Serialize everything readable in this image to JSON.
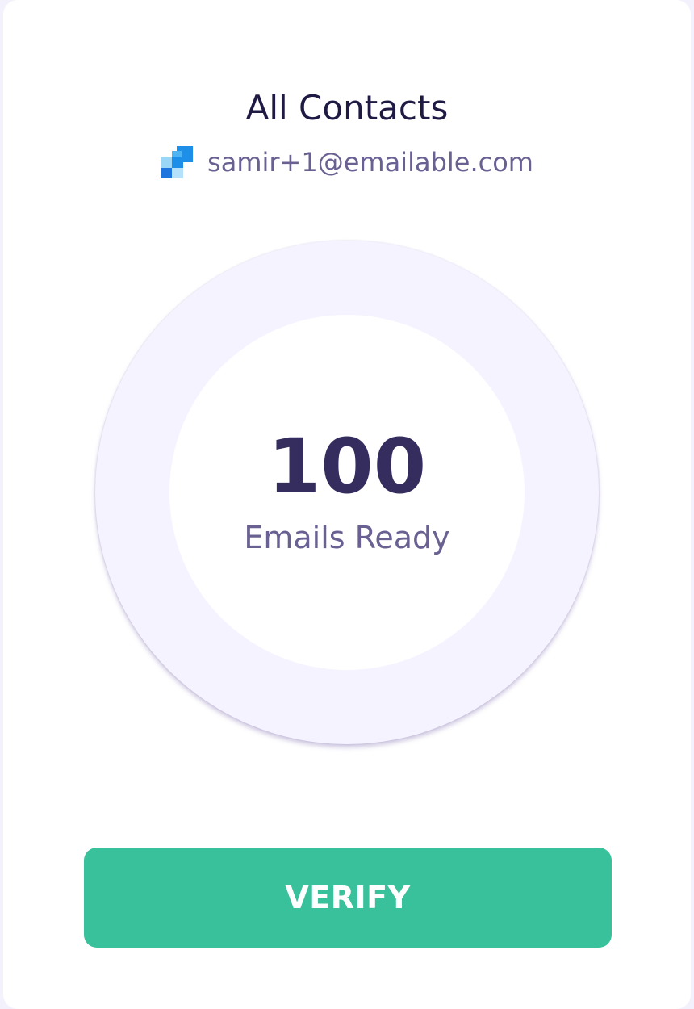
{
  "list": {
    "title": "All Contacts",
    "account_email": "samir+1@emailable.com",
    "account_icon": "emailable-logo-icon"
  },
  "summary": {
    "count": "100",
    "count_label": "Emails Ready"
  },
  "actions": {
    "verify_label": "VERIFY"
  },
  "colors": {
    "accent": "#38c19a",
    "title": "#1e1a44",
    "muted": "#6a6192",
    "ring": "#f5f3ff"
  }
}
